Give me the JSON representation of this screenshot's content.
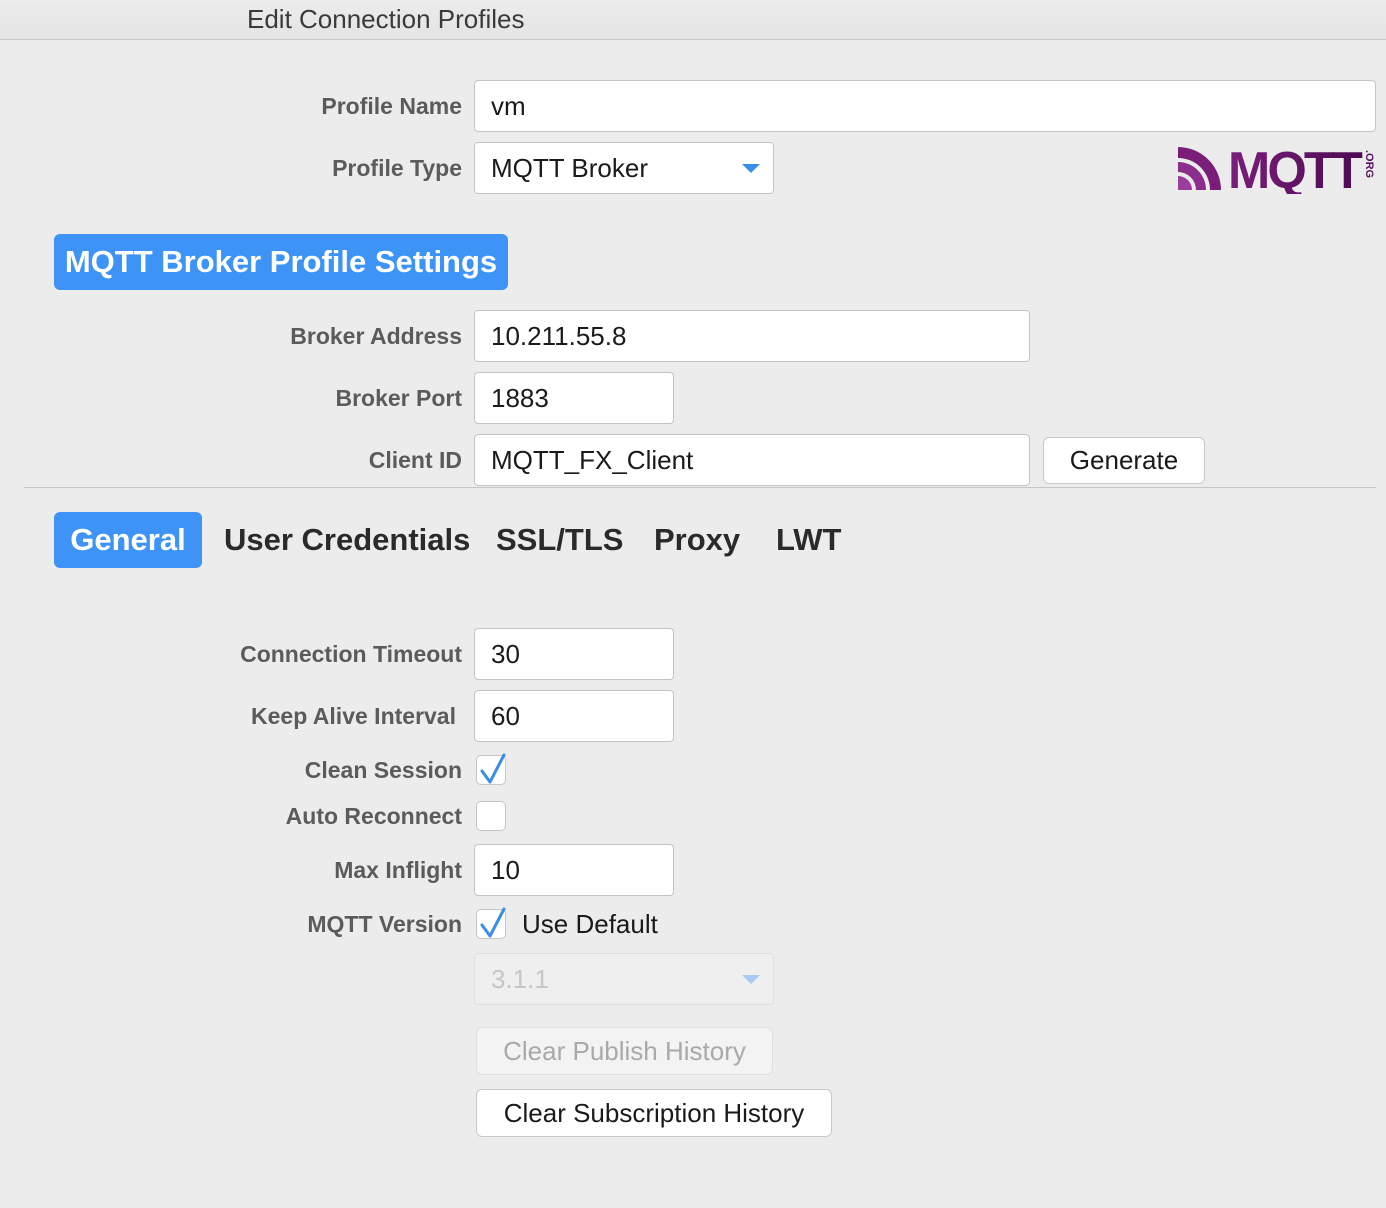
{
  "window": {
    "title": "Edit Connection Profiles"
  },
  "profile": {
    "name_label": "Profile Name",
    "name_value": "vm",
    "type_label": "Profile Type",
    "type_value": "MQTT Broker",
    "logo_text": "MQTT",
    "logo_suffix": ".ORG"
  },
  "broker_section": {
    "header": "MQTT Broker Profile Settings",
    "address_label": "Broker Address",
    "address_value": "10.211.55.8",
    "port_label": "Broker Port",
    "port_value": "1883",
    "client_id_label": "Client ID",
    "client_id_value": "MQTT_FX_Client",
    "generate_label": "Generate"
  },
  "tabs": [
    {
      "label": "General",
      "active": true
    },
    {
      "label": "User Credentials",
      "active": false
    },
    {
      "label": "SSL/TLS",
      "active": false
    },
    {
      "label": "Proxy",
      "active": false
    },
    {
      "label": "LWT",
      "active": false
    }
  ],
  "general": {
    "connection_timeout_label": "Connection Timeout",
    "connection_timeout_value": "30",
    "keep_alive_label": "Keep Alive Interval",
    "keep_alive_value": "60",
    "clean_session_label": "Clean Session",
    "clean_session_checked": true,
    "auto_reconnect_label": "Auto Reconnect",
    "auto_reconnect_checked": false,
    "max_inflight_label": "Max Inflight",
    "max_inflight_value": "10",
    "mqtt_version_label": "MQTT Version",
    "use_default_label": "Use Default",
    "use_default_checked": true,
    "version_value": "3.1.1",
    "clear_publish_label": "Clear Publish History",
    "clear_subscription_label": "Clear Subscription History"
  },
  "colors": {
    "accent": "#3d94f6",
    "background": "#ececec",
    "logo_purple": "#660066"
  }
}
